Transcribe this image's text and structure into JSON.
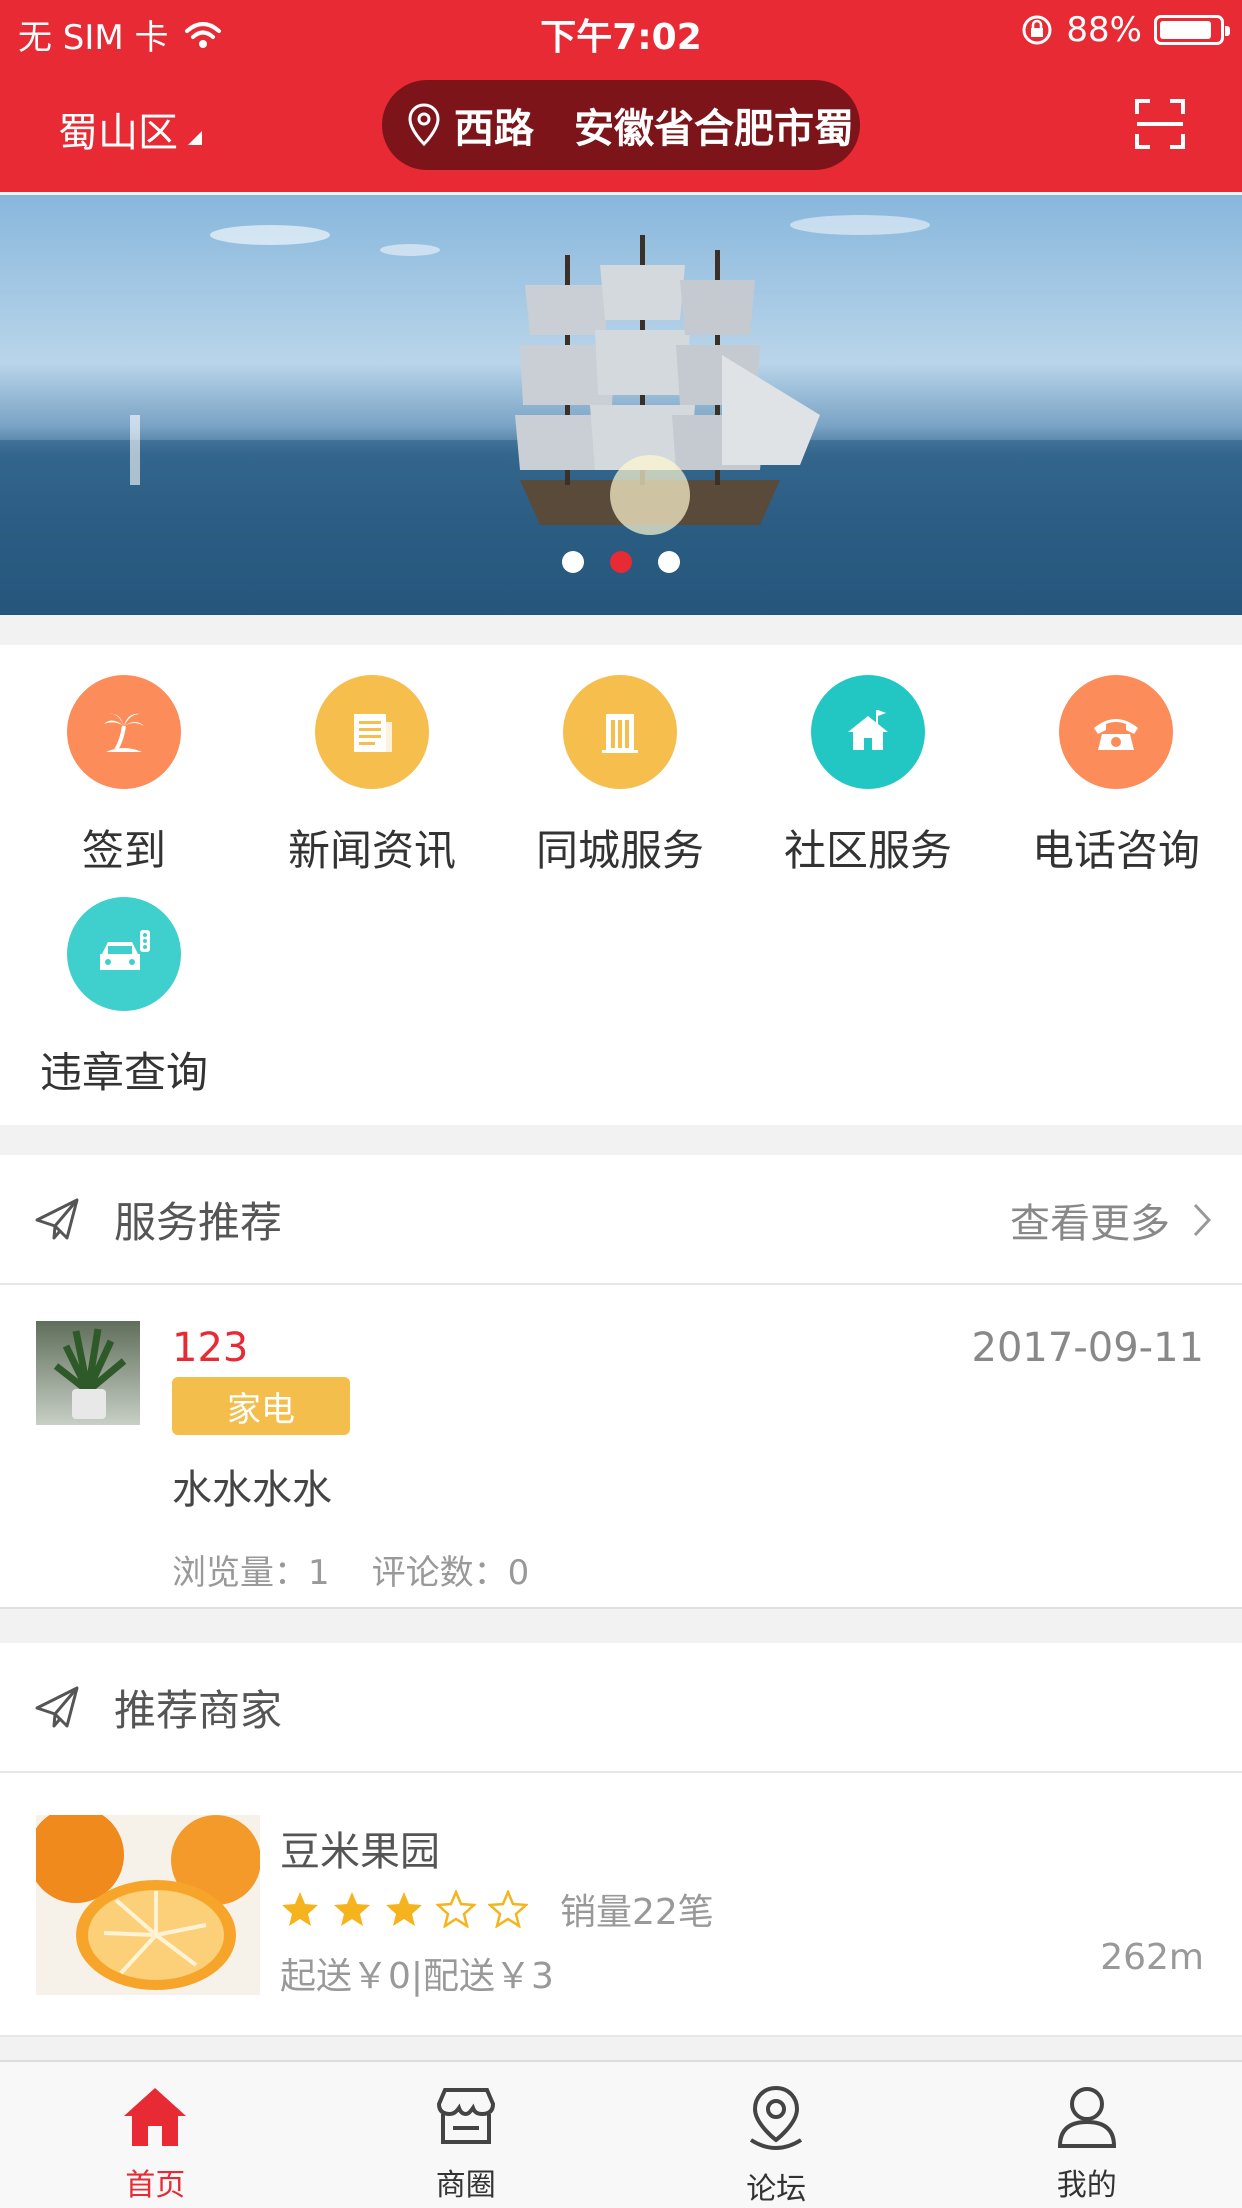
{
  "status": {
    "carrier": "无 SIM 卡",
    "time": "下午7:02",
    "battery": "88%",
    "battery_level": 0.88
  },
  "header": {
    "district": "蜀山区",
    "location": "西路　安徽省合肥市蜀"
  },
  "banner": {
    "slide_count": 3,
    "active_slide": 2
  },
  "quick_menu": [
    {
      "label": "签到",
      "icon": "palm-tree-icon",
      "color": "#fc8c5a"
    },
    {
      "label": "新闻资讯",
      "icon": "newspaper-icon",
      "color": "#f5be4d"
    },
    {
      "label": "同城服务",
      "icon": "building-icon",
      "color": "#f5be4d"
    },
    {
      "label": "社区服务",
      "icon": "house-flag-icon",
      "color": "#22c7c4"
    },
    {
      "label": "电话咨询",
      "icon": "telephone-icon",
      "color": "#fc8c5a"
    },
    {
      "label": "违章查询",
      "icon": "car-traffic-light-icon",
      "color": "#3fd0cd"
    }
  ],
  "service_section": {
    "title": "服务推荐",
    "more": "查看更多",
    "item": {
      "name": "123",
      "date": "2017-09-11",
      "tag": "家电",
      "description": "水水水水",
      "views_label": "浏览量：",
      "views": "1",
      "comments_label": "评论数：",
      "comments": "0"
    }
  },
  "merchant_section": {
    "title": "推荐商家",
    "item": {
      "name": "豆米果园",
      "rating": 3,
      "rating_max": 5,
      "sales": "销量22笔",
      "fees": "起送￥0|配送￥3",
      "distance": "262m"
    }
  },
  "tabbar": [
    {
      "label": "首页",
      "icon": "home-icon",
      "active": true
    },
    {
      "label": "商圈",
      "icon": "store-icon",
      "active": false
    },
    {
      "label": "论坛",
      "icon": "map-pin-icon",
      "active": false
    },
    {
      "label": "我的",
      "icon": "user-icon",
      "active": false
    }
  ],
  "colors": {
    "brand": "#e72a33",
    "tag": "#f4be4d",
    "star": "#f5b41e"
  }
}
